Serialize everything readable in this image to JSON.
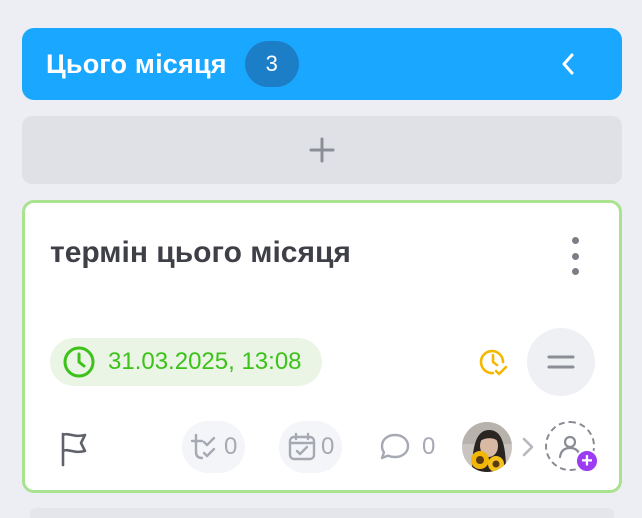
{
  "column": {
    "title": "Цього місяця",
    "count": "3"
  },
  "card": {
    "title": "термін цього місяця",
    "deadline": "31.03.2025, 13:08",
    "subtasks_count": "0",
    "dates_count": "0",
    "comments_count": "0"
  },
  "icons": {
    "collapse": "chevron-left-icon",
    "add": "plus-icon",
    "menu": "kebab-icon",
    "deadline": "clock-icon",
    "time_status": "clock-check-icon",
    "priority": "equals-icon",
    "flag": "flag-icon",
    "subtasks": "checklist-icon",
    "calendar": "calendar-check-icon",
    "comments": "comment-icon",
    "add_user": "user-plus-icon"
  },
  "colors": {
    "header": "#1aa7ff",
    "badge": "#1d7ec8",
    "card_border": "#a9e38f",
    "deadline": "#3cc21a",
    "warning": "#f5b800",
    "add_user": "#9b3cf3"
  }
}
